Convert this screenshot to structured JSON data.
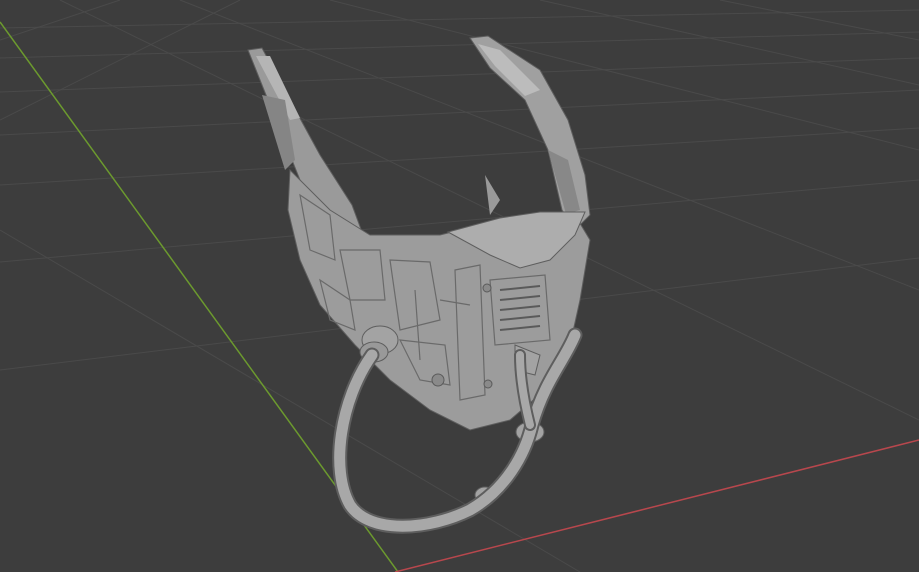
{
  "viewport": {
    "mode": "3d-viewport",
    "shading": "solid",
    "background_color": "#3d3d3d",
    "grid_color": "#4a4a4a",
    "x_axis_color": "#b8474d",
    "y_axis_color": "#6c9a2e",
    "object": {
      "icon": "cyber-mask-mesh",
      "base_color": "#9e9e9e",
      "shadow_color": "#6b6b6b",
      "highlight_color": "#bdbdbd"
    }
  }
}
